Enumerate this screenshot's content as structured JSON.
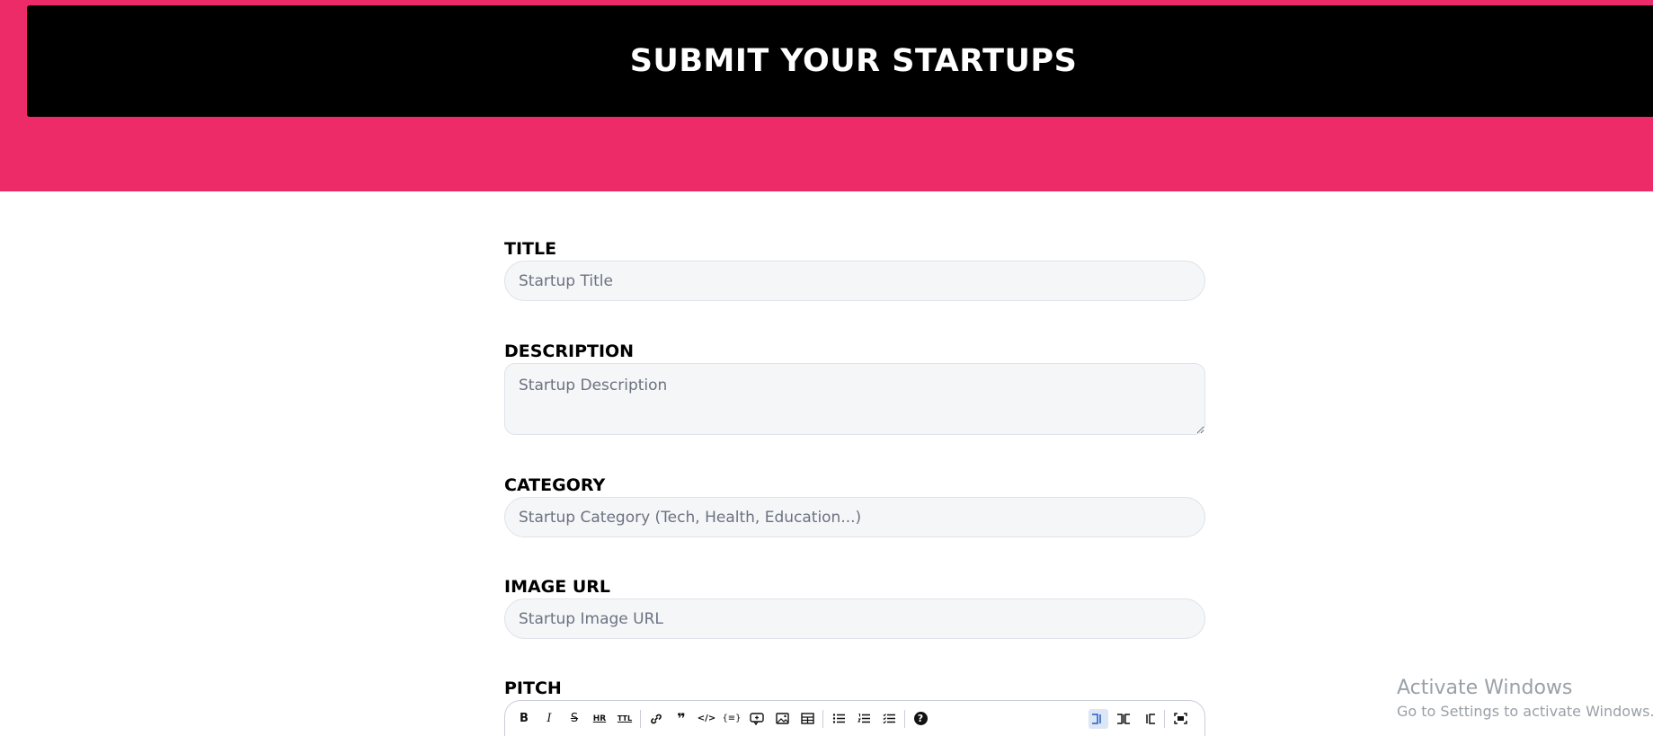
{
  "hero": {
    "title": "SUBMIT YOUR STARTUPS",
    "background_color": "#ee2b69",
    "banner_color": "#000000"
  },
  "form": {
    "fields": [
      {
        "label": "TITLE",
        "placeholder": "Startup Title"
      },
      {
        "label": "DESCRIPTION",
        "placeholder": "Startup Description"
      },
      {
        "label": "CATEGORY",
        "placeholder": "Startup Category (Tech, Health, Education...)"
      },
      {
        "label": "IMAGE URL",
        "placeholder": "Startup Image URL"
      },
      {
        "label": "PITCH"
      }
    ],
    "editor_toolbar": {
      "bold": "B",
      "italic": "I",
      "strikethrough": "S",
      "hr": "HR",
      "title": "TTL",
      "link_icon": "link-icon",
      "quote": "❞",
      "code": "</>",
      "code_block": "{≡}",
      "comment_icon": "comment-icon",
      "image_icon": "image-icon",
      "table_icon": "table-icon",
      "unordered_list_icon": "unordered-list-icon",
      "ordered_list_icon": "ordered-list-icon",
      "checklist_icon": "checklist-icon",
      "help": "?",
      "edit_mode_icon": "edit-mode-icon",
      "live_mode_icon": "live-mode-icon",
      "preview_mode_icon": "preview-mode-icon",
      "fullscreen_icon": "fullscreen-icon"
    }
  },
  "watermark": {
    "title": "Activate Windows",
    "subtitle": "Go to Settings to activate Windows."
  }
}
